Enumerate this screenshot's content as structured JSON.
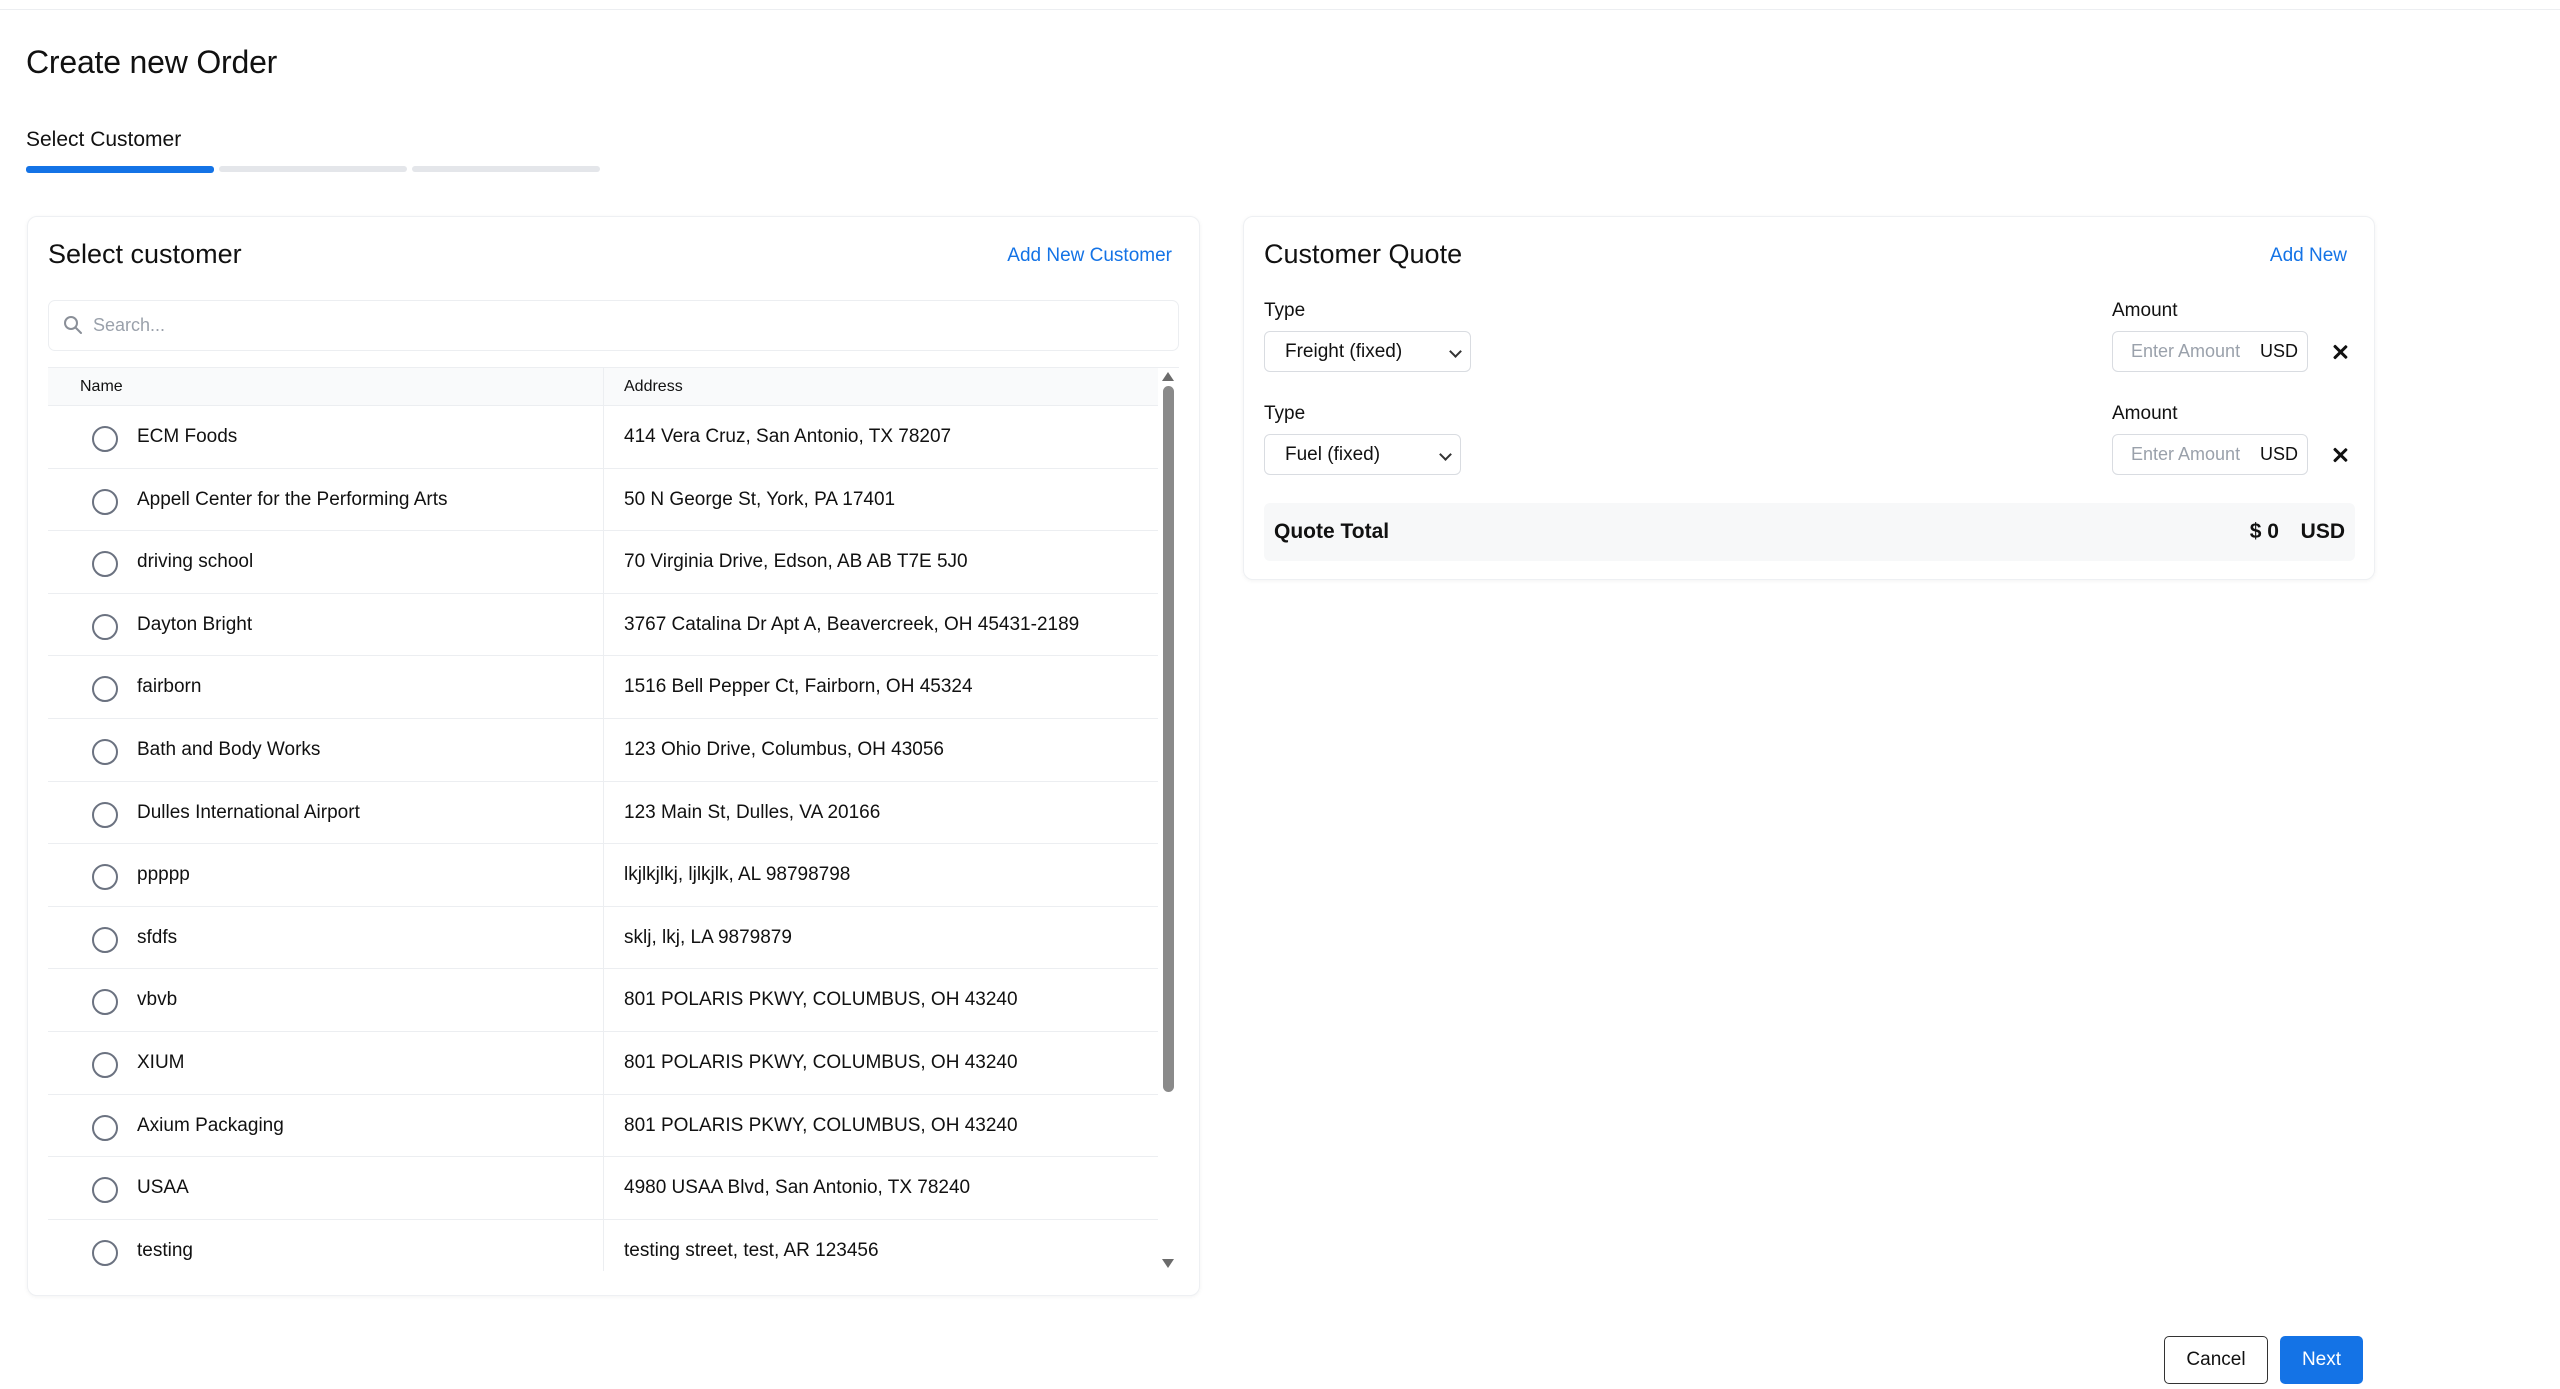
{
  "page": {
    "title": "Create new Order"
  },
  "stepper": {
    "current_label": "Select Customer",
    "steps_total": 3,
    "current_step": 1,
    "active_color": "#1473e6",
    "inactive_color": "#e4e6ea"
  },
  "customer_panel": {
    "title": "Select customer",
    "add_link": "Add New Customer",
    "search": {
      "placeholder": "Search...",
      "value": ""
    },
    "columns": {
      "name": "Name",
      "address": "Address"
    },
    "rows": [
      {
        "name": "ECM Foods",
        "address": "414 Vera Cruz, San Antonio, TX 78207",
        "selected": false
      },
      {
        "name": "Appell Center for the Performing Arts",
        "address": "50 N George St, York, PA 17401",
        "selected": false
      },
      {
        "name": "driving school",
        "address": "70 Virginia Drive, Edson, AB AB T7E 5J0",
        "selected": false
      },
      {
        "name": "Dayton Bright",
        "address": "3767 Catalina Dr Apt A, Beavercreek, OH 45431-2189",
        "selected": false
      },
      {
        "name": "fairborn",
        "address": "1516 Bell Pepper Ct, Fairborn, OH 45324",
        "selected": false
      },
      {
        "name": "Bath and Body Works",
        "address": "123 Ohio Drive, Columbus, OH 43056",
        "selected": false
      },
      {
        "name": "Dulles International Airport",
        "address": "123 Main St, Dulles, VA 20166",
        "selected": false
      },
      {
        "name": "ppppp",
        "address": "lkjlkjlkj, ljlkjlk, AL 98798798",
        "selected": false
      },
      {
        "name": "sfdfs",
        "address": "sklj, lkj, LA 9879879",
        "selected": false
      },
      {
        "name": "vbvb",
        "address": "801 POLARIS PKWY, COLUMBUS, OH 43240",
        "selected": false
      },
      {
        "name": "XIUM",
        "address": "801 POLARIS PKWY, COLUMBUS, OH 43240",
        "selected": false
      },
      {
        "name": "Axium Packaging",
        "address": "801 POLARIS PKWY, COLUMBUS, OH 43240",
        "selected": false
      },
      {
        "name": "USAA",
        "address": "4980 USAA Blvd, San Antonio, TX 78240",
        "selected": false
      },
      {
        "name": "testing",
        "address": "testing street, test, AR 123456",
        "selected": false
      }
    ]
  },
  "quote_panel": {
    "title": "Customer Quote",
    "add_link": "Add New",
    "lines": [
      {
        "type_label": "Type",
        "type_value": "Freight (fixed)",
        "amount_label": "Amount",
        "amount_placeholder": "Enter Amount",
        "amount_value": "",
        "currency": "USD"
      },
      {
        "type_label": "Type",
        "type_value": "Fuel (fixed)",
        "amount_label": "Amount",
        "amount_placeholder": "Enter Amount",
        "amount_value": "",
        "currency": "USD"
      }
    ],
    "total": {
      "label": "Quote Total",
      "amount": "$ 0",
      "currency": "USD"
    }
  },
  "footer": {
    "cancel_label": "Cancel",
    "next_label": "Next"
  }
}
